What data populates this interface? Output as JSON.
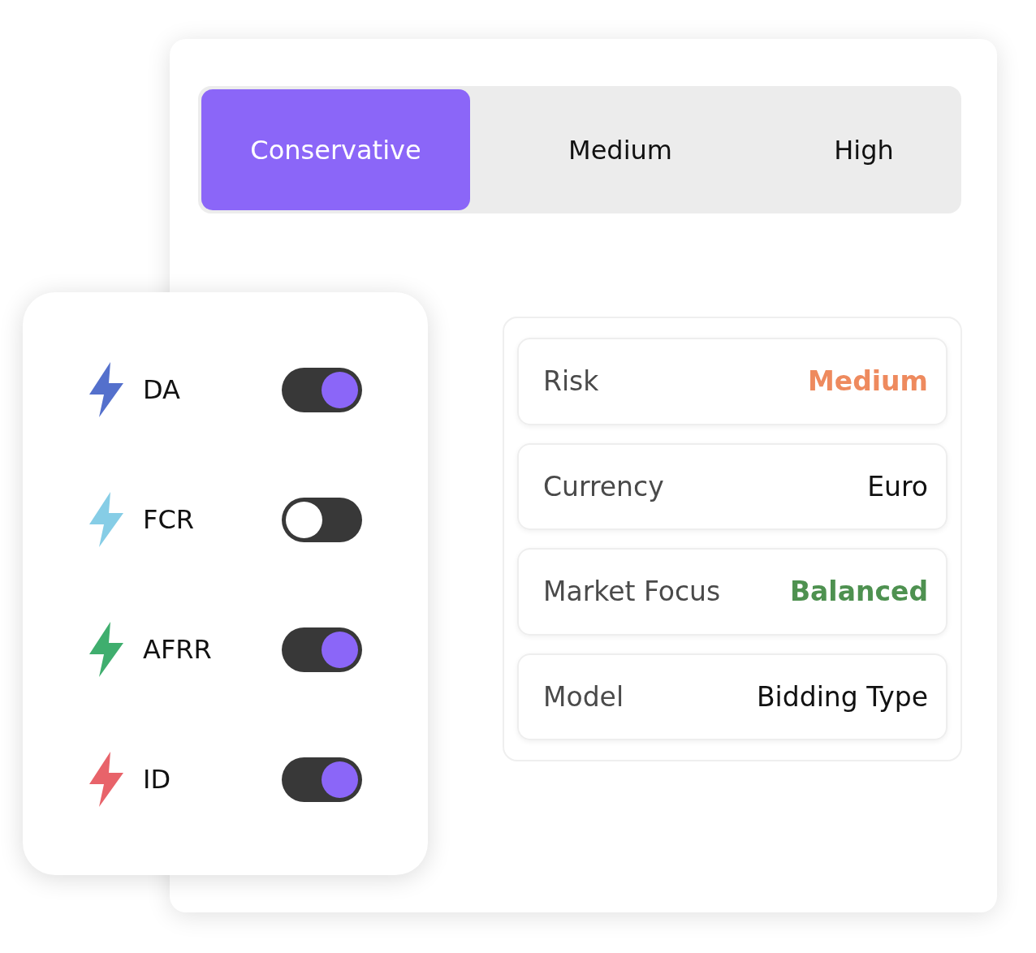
{
  "risk_tabs": [
    {
      "label": "Conservative",
      "selected": true
    },
    {
      "label": "Medium",
      "selected": false
    },
    {
      "label": "High",
      "selected": false
    }
  ],
  "markets": [
    {
      "label": "DA",
      "color": "#5470cc",
      "on": true
    },
    {
      "label": "FCR",
      "color": "#86cde6",
      "on": false
    },
    {
      "label": "AFRR",
      "color": "#3fae6e",
      "on": true
    },
    {
      "label": "ID",
      "color": "#e8636a",
      "on": true
    }
  ],
  "settings": [
    {
      "label": "Risk",
      "value": "Medium",
      "color": "#ee8a5e",
      "bold": true
    },
    {
      "label": "Currency",
      "value": "Euro",
      "color": "#111111",
      "bold": false
    },
    {
      "label": "Market Focus",
      "value": "Balanced",
      "color": "#4e9150",
      "bold": true
    },
    {
      "label": "Model",
      "value": "Bidding Type",
      "color": "#111111",
      "bold": false
    }
  ]
}
